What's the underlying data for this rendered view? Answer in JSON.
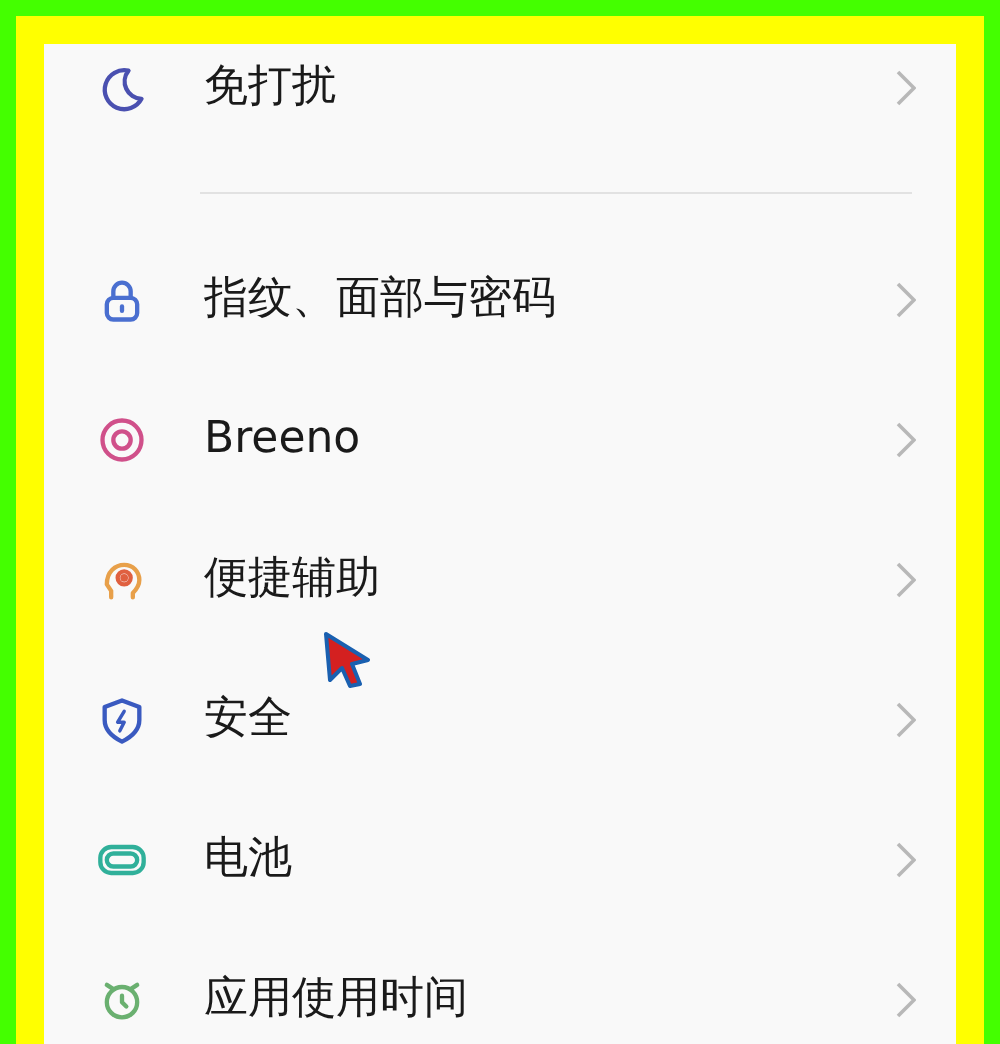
{
  "sections": [
    {
      "items": [
        {
          "label": "免打扰"
        }
      ]
    },
    {
      "items": [
        {
          "label": "指纹、面部与密码"
        },
        {
          "label": "Breeno"
        },
        {
          "label": "便捷辅助"
        },
        {
          "label": "安全"
        },
        {
          "label": "电池"
        },
        {
          "label": "应用使用时间"
        }
      ]
    }
  ]
}
